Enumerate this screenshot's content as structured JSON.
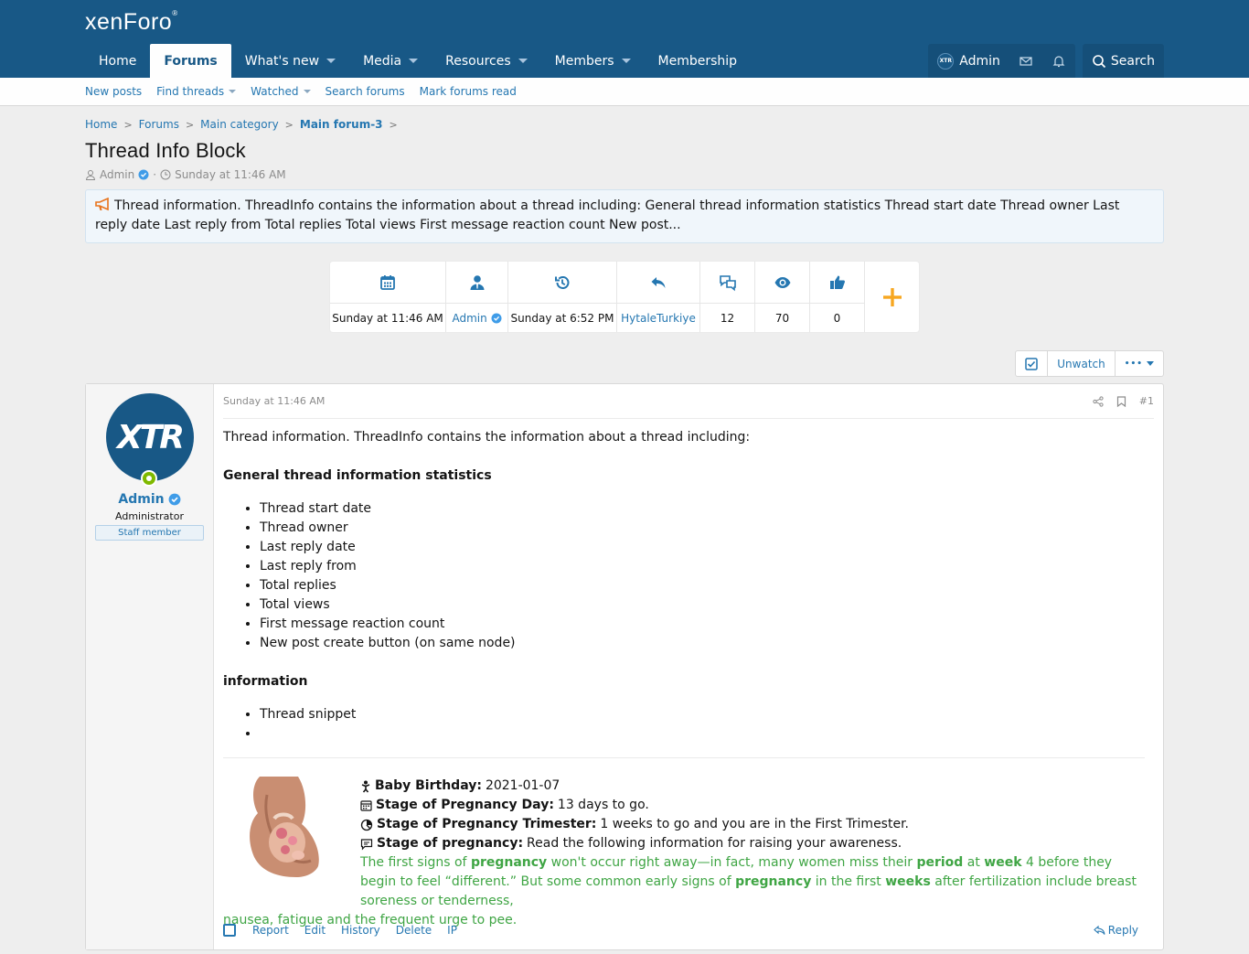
{
  "header": {
    "logo": "xenForo",
    "logo_mark": "®",
    "nav": [
      {
        "label": "Home",
        "active": false,
        "caret": false
      },
      {
        "label": "Forums",
        "active": true,
        "caret": false
      },
      {
        "label": "What's new",
        "active": false,
        "caret": true
      },
      {
        "label": "Media",
        "active": false,
        "caret": true
      },
      {
        "label": "Resources",
        "active": false,
        "caret": true
      },
      {
        "label": "Members",
        "active": false,
        "caret": true
      },
      {
        "label": "Membership",
        "active": false,
        "caret": false
      }
    ],
    "user_label": "Admin",
    "avatar_text": "XTR",
    "search_label": "Search"
  },
  "subnav": {
    "new_posts": "New posts",
    "find_threads": "Find threads",
    "watched": "Watched",
    "search_forums": "Search forums",
    "mark_read": "Mark forums read"
  },
  "breadcrumb": {
    "home": "Home",
    "forums": "Forums",
    "category": "Main category",
    "forum": "Main forum-3"
  },
  "thread": {
    "title": "Thread Info Block",
    "author": "Admin",
    "sep": "·",
    "date": "Sunday at 11:46 AM"
  },
  "notice": "Thread information. ThreadInfo contains the information about a thread including: General thread information statistics Thread start date Thread owner Last reply date Last reply from Total replies Total views First message reaction count New post...",
  "stats": {
    "start_date": "Sunday at 11:46 AM",
    "owner": "Admin",
    "last_reply_date": "Sunday at 6:52 PM",
    "last_reply_from": "HytaleTurkiye",
    "replies": "12",
    "views": "70",
    "reactions": "0"
  },
  "actions": {
    "unwatch": "Unwatch",
    "more": "•••"
  },
  "post": {
    "date": "Sunday at 11:46 AM",
    "number": "#1",
    "user": {
      "name": "Admin",
      "title": "Administrator",
      "banner": "Staff member",
      "avatar_text": "XTR"
    },
    "intro": "Thread information. ThreadInfo contains the information about a thread including:",
    "heading1": "General thread information statistics",
    "list1": [
      "Thread start date",
      "Thread owner",
      "Last reply date",
      "Last reply from",
      "Total replies",
      "Total views",
      "First message reaction count",
      "New post create button (on same node)"
    ],
    "heading2": "information",
    "list2": [
      "Thread snippet",
      ""
    ]
  },
  "signature": {
    "birthday_label": "Baby Birthday:",
    "birthday_value": "2021-01-07",
    "day_label": "Stage of Pregnancy Day:",
    "day_value": "13 days to go.",
    "trimester_label": "Stage of Pregnancy Trimester:",
    "trimester_value": "1 weeks to go and you are in the First Trimester.",
    "stage_label": "Stage of pregnancy:",
    "stage_value": "Read the following information for raising your awareness.",
    "g1": "The first signs of ",
    "g2": "pregnancy",
    "g3": " won't occur right away—in fact, many women miss their ",
    "g4": "period",
    "g5": " at ",
    "g6": "week",
    "g7": " 4 before they begin to feel “different.” But some common early signs of ",
    "g8": "pregnancy",
    "g9": " in the first ",
    "g10": "weeks",
    "g11": " after fertilization include breast soreness or tenderness,",
    "tail": "nausea, fatigue and the frequent urge to pee."
  },
  "footer_actions": {
    "report": "Report",
    "edit": "Edit",
    "history": "History",
    "delete": "Delete",
    "ip": "IP",
    "reply": "Reply"
  },
  "colors": {
    "header": "#185886",
    "link": "#2577b1",
    "accent_orange": "#f7a721",
    "green": "#3fa544"
  }
}
